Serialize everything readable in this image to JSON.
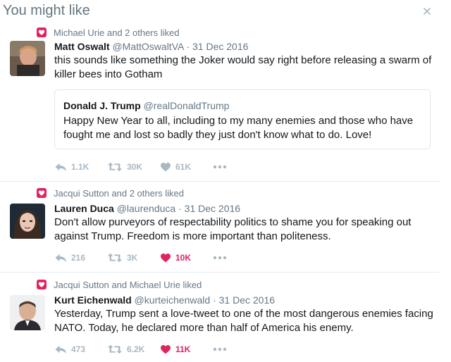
{
  "header": {
    "title": "You might like"
  },
  "tweets": [
    {
      "context": "Michael Urie and 2 others liked",
      "name": "Matt Oswalt",
      "handle": "@MattOswaltVA",
      "sep": "·",
      "date": "31 Dec 2016",
      "text": "this sounds like something the Joker would say right before releasing a swarm of killer bees into Gotham",
      "quote": {
        "name": "Donald J. Trump",
        "handle": "@realDonaldTrump",
        "text": "Happy New Year to all, including to my many enemies and those who have fought me and lost so badly they just don't know what to do. Love!"
      },
      "replies": "1.1K",
      "retweets": "30K",
      "likes": "61K",
      "liked": false
    },
    {
      "context": "Jacqui Sutton and 2 others liked",
      "name": "Lauren Duca",
      "handle": "@laurenduca",
      "sep": "·",
      "date": "31 Dec 2016",
      "text": "Don't allow purveyors of respectability politics to shame you for speaking out against Trump. Freedom is more important than politeness.",
      "replies": "216",
      "retweets": "3K",
      "likes": "10K",
      "liked": true
    },
    {
      "context": "Jacqui Sutton and Michael Urie liked",
      "name": "Kurt Eichenwald",
      "handle": "@kurteichenwald",
      "sep": "·",
      "date": "31 Dec 2016",
      "text": "Yesterday, Trump sent a love-tweet to one of the most dangerous enemies facing NATO. Today, he declared more than half of America his enemy.",
      "replies": "473",
      "retweets": "6.2K",
      "likes": "11K",
      "liked": true
    }
  ],
  "colors": {
    "like_active": "#e0245e",
    "action_gray": "#aab8c2",
    "secondary_text": "#657786"
  }
}
